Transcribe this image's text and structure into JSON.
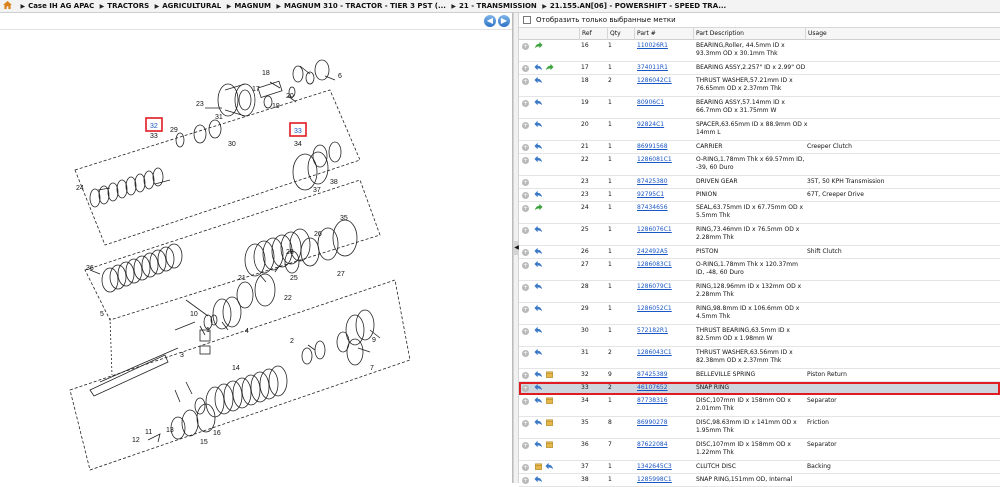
{
  "breadcrumb": [
    "Case IH AG APAC",
    "TRACTORS",
    "AGRICULTURAL",
    "MAGNUM",
    "MAGNUM 310 - TRACTOR - TIER 3 PST (...",
    "21 - TRANSMISSION",
    "21.155.AN[06] - POWERSHIFT - SPEED TRA..."
  ],
  "filter_label": "Отобразить только выбранные метки",
  "columns": {
    "ref": "Ref",
    "qty": "Qty",
    "part": "Part #",
    "desc": "Part Description",
    "usage": "Usage"
  },
  "diagram": {
    "callouts": [
      "1",
      "2",
      "3",
      "4",
      "5",
      "6",
      "7",
      "9",
      "10",
      "11",
      "12",
      "13",
      "14",
      "15",
      "16",
      "17",
      "18",
      "19",
      "20",
      "21",
      "22",
      "23",
      "24",
      "25",
      "26",
      "27",
      "28",
      "29",
      "30",
      "31",
      "32",
      "33",
      "33",
      "34",
      "35",
      "36",
      "37",
      "38"
    ]
  },
  "parts": [
    {
      "ref": "16",
      "qty": "1",
      "part": "110026R1",
      "desc": "BEARING,Roller, 44.5mm ID x 93.3mm OD x 30.1mm Thk",
      "usage": "",
      "i1": "arrow-green",
      "i2": ""
    },
    {
      "ref": "17",
      "qty": "1",
      "part": "374011R1",
      "desc": "BEARING ASSY,2.257\" ID x 2.99\" OD",
      "usage": "",
      "i1": "undo",
      "i2": "arrow-green"
    },
    {
      "ref": "18",
      "qty": "2",
      "part": "1286042C1",
      "desc": "THRUST WASHER,57.21mm ID x 76.65mm OD x 2.37mm Thk",
      "usage": "",
      "i1": "undo",
      "i2": ""
    },
    {
      "ref": "19",
      "qty": "1",
      "part": "80906C1",
      "desc": "BEARING ASSY,57.14mm ID x 66.7mm OD x 31.75mm W",
      "usage": "",
      "i1": "undo",
      "i2": ""
    },
    {
      "ref": "20",
      "qty": "1",
      "part": "92824C1",
      "desc": "SPACER,63.65mm ID x 88.9mm OD x 14mm L",
      "usage": "",
      "i1": "undo",
      "i2": ""
    },
    {
      "ref": "21",
      "qty": "1",
      "part": "86991568",
      "desc": "CARRIER",
      "usage": "Creeper Clutch",
      "i1": "undo",
      "i2": ""
    },
    {
      "ref": "22",
      "qty": "1",
      "part": "1286081C1",
      "desc": "O-RING,1.78mm Thk x 69.57mm ID, -39, 60 Duro",
      "usage": "",
      "i1": "undo",
      "i2": ""
    },
    {
      "ref": "23",
      "qty": "1",
      "part": "87425380",
      "desc": "DRIVEN GEAR",
      "usage": "35T, 50 KPH Transmission",
      "i1": "",
      "i2": ""
    },
    {
      "ref": "23",
      "qty": "1",
      "part": "92795C1",
      "desc": "PINION",
      "usage": "67T, Creeper Drive",
      "i1": "undo",
      "i2": ""
    },
    {
      "ref": "24",
      "qty": "1",
      "part": "87434656",
      "desc": "SEAL,63.75mm ID x 67.75mm OD x 5.5mm Thk",
      "usage": "",
      "i1": "arrow-green",
      "i2": ""
    },
    {
      "ref": "25",
      "qty": "1",
      "part": "1286076C1",
      "desc": "RING,73.46mm ID x 76.5mm OD x 2.28mm Thk",
      "usage": "",
      "i1": "undo",
      "i2": ""
    },
    {
      "ref": "26",
      "qty": "1",
      "part": "242492A5",
      "desc": "PISTON",
      "usage": "Shift Clutch",
      "i1": "undo",
      "i2": ""
    },
    {
      "ref": "27",
      "qty": "1",
      "part": "1286083C1",
      "desc": "O-RING,1.78mm Thk x 120.37mm ID, -48, 60 Duro",
      "usage": "",
      "i1": "undo",
      "i2": ""
    },
    {
      "ref": "28",
      "qty": "1",
      "part": "1286079C1",
      "desc": "RING,128.96mm ID x 132mm OD x 2.28mm Thk",
      "usage": "",
      "i1": "undo",
      "i2": ""
    },
    {
      "ref": "29",
      "qty": "1",
      "part": "1286052C1",
      "desc": "RING,98.8mm ID x 106.6mm OD x 4.5mm Thk",
      "usage": "",
      "i1": "undo",
      "i2": ""
    },
    {
      "ref": "30",
      "qty": "1",
      "part": "572182R1",
      "desc": "THRUST BEARING,63.5mm ID x 82.5mm OD x 1.98mm W",
      "usage": "",
      "i1": "undo",
      "i2": ""
    },
    {
      "ref": "31",
      "qty": "2",
      "part": "1286043C1",
      "desc": "THRUST WASHER,63.56mm ID x 82.38mm OD x 2.37mm Thk",
      "usage": "",
      "i1": "undo",
      "i2": ""
    },
    {
      "ref": "32",
      "qty": "9",
      "part": "87425389",
      "desc": "BELLEVILLE SPRING",
      "usage": "Piston Return",
      "i1": "undo",
      "i2": "box"
    },
    {
      "ref": "33",
      "qty": "2",
      "part": "46107652",
      "desc": "SNAP RING",
      "usage": "",
      "i1": "undo",
      "i2": ""
    },
    {
      "ref": "34",
      "qty": "1",
      "part": "87738316",
      "desc": "DISC,107mm ID x 158mm OD x 2.01mm Thk",
      "usage": "Separator",
      "i1": "undo",
      "i2": "box"
    },
    {
      "ref": "35",
      "qty": "8",
      "part": "86990278",
      "desc": "DISC,98.63mm ID x 141mm OD x 1.95mm Thk",
      "usage": "Friction",
      "i1": "undo",
      "i2": "box"
    },
    {
      "ref": "36",
      "qty": "7",
      "part": "87622084",
      "desc": "DISC,107mm ID x 158mm OD x 1.22mm Thk",
      "usage": "Separator",
      "i1": "undo",
      "i2": "box"
    },
    {
      "ref": "37",
      "qty": "1",
      "part": "1342645C3",
      "desc": "CLUTCH DISC",
      "usage": "Backing",
      "i1": "box",
      "i2": "undo"
    },
    {
      "ref": "38",
      "qty": "1",
      "part": "1285998C1",
      "desc": "SNAP RING,151mm OD, Internal",
      "usage": "",
      "i1": "undo",
      "i2": ""
    }
  ]
}
